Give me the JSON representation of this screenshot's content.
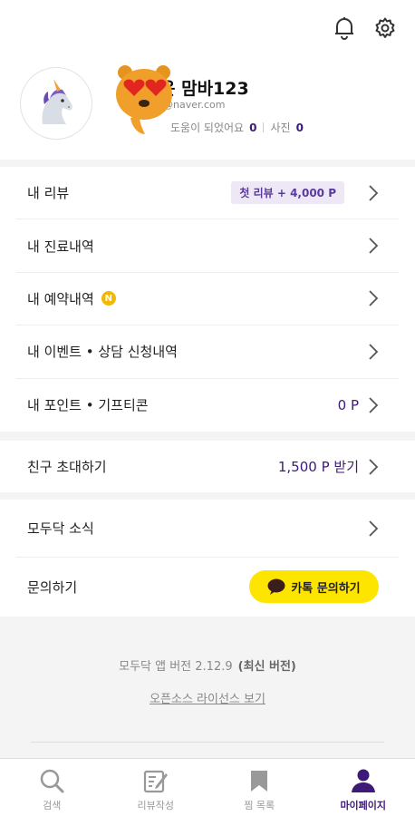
{
  "profile": {
    "nickname": "운 맘바123",
    "email": "@naver.com",
    "helpful_label": "도움이 되었어요",
    "helpful_count": "0",
    "photos_label": "사진",
    "photos_count": "0",
    "avatar_icon": "unicorn-icon"
  },
  "topbar": {
    "icons": [
      "bell-icon",
      "gear-icon"
    ]
  },
  "menu": {
    "my_review": "내 리뷰",
    "first_review_badge": "첫 리뷰 + 4,000 P",
    "treatment_history": "내 진료내역",
    "reservation_history": "내 예약내역",
    "new_badge": "N",
    "event_history": "내 이벤트 • 상담 신청내역",
    "points": "내 포인트 • 기프티콘",
    "points_value": "0 P",
    "invite": "친구 초대하기",
    "invite_reward": "1,500 P 받기",
    "news": "모두닥 소식",
    "contact": "문의하기",
    "kakao_button": "카톡 문의하기"
  },
  "footer": {
    "version": "모두닥 앱 버전 2.12.9",
    "latest": "(최신 버전)",
    "license_link": "오픈소스 라이선스 보기"
  },
  "bottom_nav": {
    "search": "검색",
    "write_review": "리뷰작성",
    "bookmarks": "찜 목록",
    "mypage": "마이페이지"
  },
  "colors": {
    "accent": "#3d1a78",
    "kakao_yellow": "#fee500",
    "badge_bg": "#ede7f6"
  }
}
